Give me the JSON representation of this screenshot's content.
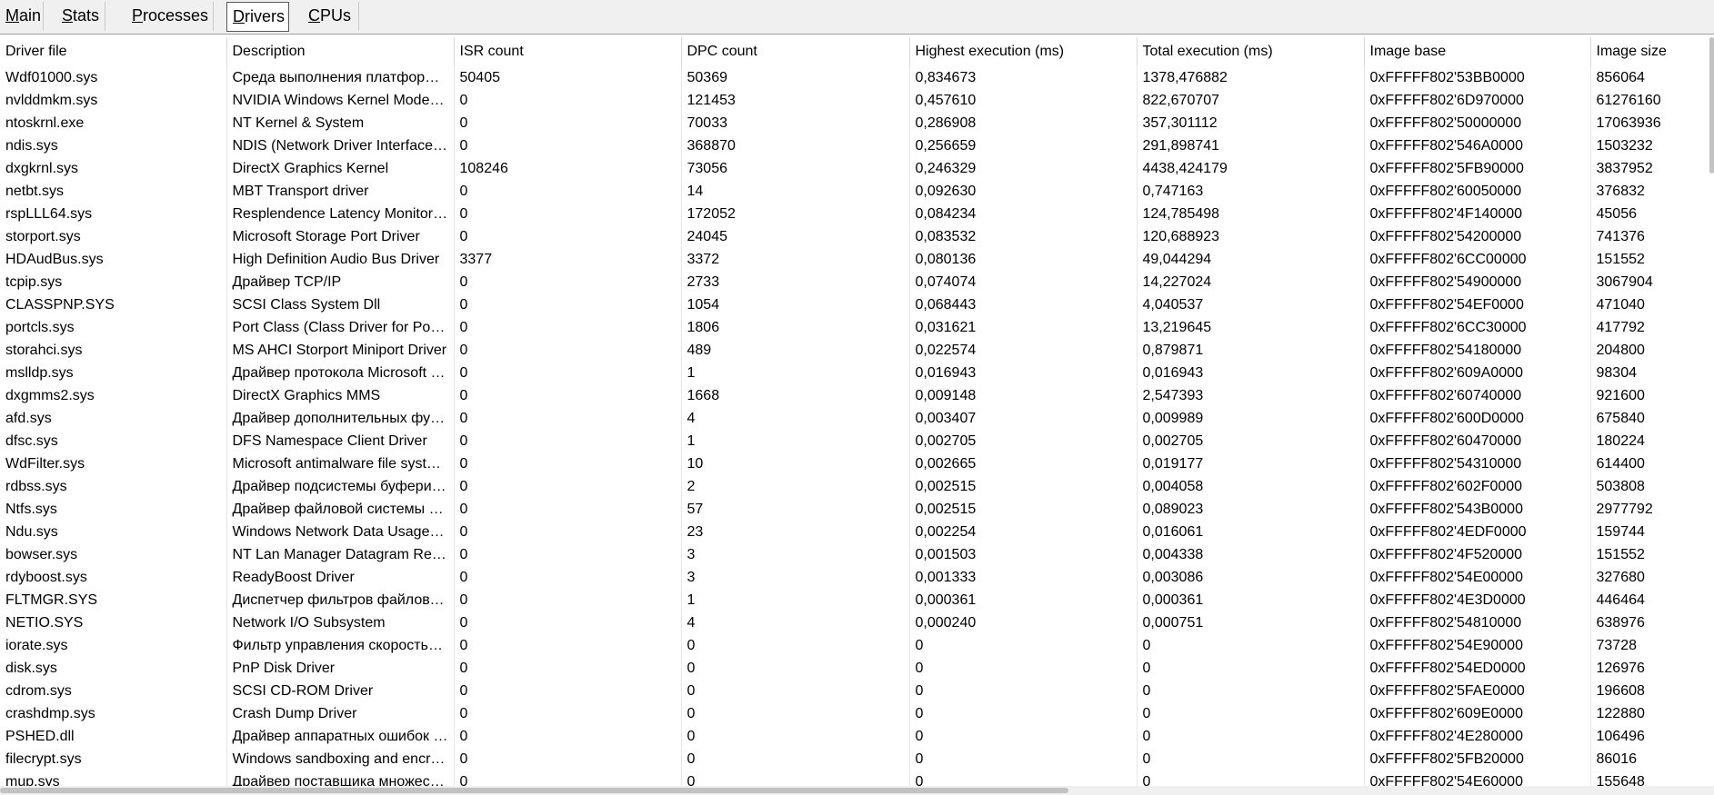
{
  "tabs": [
    {
      "key": "M",
      "rest": "ain",
      "active": false
    },
    {
      "key": "S",
      "rest": "tats",
      "active": false
    },
    {
      "key": "P",
      "rest": "rocesses",
      "active": false
    },
    {
      "key": "D",
      "rest": "rivers",
      "active": true
    },
    {
      "key": "C",
      "rest": "PUs",
      "active": false
    }
  ],
  "columns": [
    "Driver file",
    "Description",
    "ISR count",
    "DPC count",
    "Highest execution (ms)",
    "Total execution (ms)",
    "Image base",
    "Image size"
  ],
  "rows": [
    [
      "Wdf01000.sys",
      "Среда выполнения платформы драйверов ядра",
      "50405",
      "50369",
      "0,834673",
      "1378,476882",
      "0xFFFFF802'53BB0000",
      "856064"
    ],
    [
      "nvlddmkm.sys",
      "NVIDIA Windows Kernel Mode Driver",
      "0",
      "121453",
      "0,457610",
      "822,670707",
      "0xFFFFF802'6D970000",
      "61276160"
    ],
    [
      "ntoskrnl.exe",
      "NT Kernel & System",
      "0",
      "70033",
      "0,286908",
      "357,301112",
      "0xFFFFF802'50000000",
      "17063936"
    ],
    [
      "ndis.sys",
      "NDIS (Network Driver Interface Specification)",
      "0",
      "368870",
      "0,256659",
      "291,898741",
      "0xFFFFF802'546A0000",
      "1503232"
    ],
    [
      "dxgkrnl.sys",
      "DirectX Graphics Kernel",
      "108246",
      "73056",
      "0,246329",
      "4438,424179",
      "0xFFFFF802'5FB90000",
      "3837952"
    ],
    [
      "netbt.sys",
      "MBT Transport driver",
      "0",
      "14",
      "0,092630",
      "0,747163",
      "0xFFFFF802'60050000",
      "376832"
    ],
    [
      "rspLLL64.sys",
      "Resplendence Latency Monitoring Driver",
      "0",
      "172052",
      "0,084234",
      "124,785498",
      "0xFFFFF802'4F140000",
      "45056"
    ],
    [
      "storport.sys",
      "Microsoft Storage Port Driver",
      "0",
      "24045",
      "0,083532",
      "120,688923",
      "0xFFFFF802'54200000",
      "741376"
    ],
    [
      "HDAudBus.sys",
      "High Definition Audio Bus Driver",
      "3377",
      "3372",
      "0,080136",
      "49,044294",
      "0xFFFFF802'6CC00000",
      "151552"
    ],
    [
      "tcpip.sys",
      "Драйвер TCP/IP",
      "0",
      "2733",
      "0,074074",
      "14,227024",
      "0xFFFFF802'54900000",
      "3067904"
    ],
    [
      "CLASSPNP.SYS",
      "SCSI Class System Dll",
      "0",
      "1054",
      "0,068443",
      "4,040537",
      "0xFFFFF802'54EF0000",
      "471040"
    ],
    [
      "portcls.sys",
      "Port Class (Class Driver for Port/Miniport Devices)",
      "0",
      "1806",
      "0,031621",
      "13,219645",
      "0xFFFFF802'6CC30000",
      "417792"
    ],
    [
      "storahci.sys",
      "MS AHCI Storport Miniport Driver",
      "0",
      "489",
      "0,022574",
      "0,879871",
      "0xFFFFF802'54180000",
      "204800"
    ],
    [
      "mslldp.sys",
      "Драйвер протокола Microsoft LLDP",
      "0",
      "1",
      "0,016943",
      "0,016943",
      "0xFFFFF802'609A0000",
      "98304"
    ],
    [
      "dxgmms2.sys",
      "DirectX Graphics MMS",
      "0",
      "1668",
      "0,009148",
      "2,547393",
      "0xFFFFF802'60740000",
      "921600"
    ],
    [
      "afd.sys",
      "Драйвер дополнительных функций",
      "0",
      "4",
      "0,003407",
      "0,009989",
      "0xFFFFF802'600D0000",
      "675840"
    ],
    [
      "dfsc.sys",
      "DFS Namespace Client Driver",
      "0",
      "1",
      "0,002705",
      "0,002705",
      "0xFFFFF802'60470000",
      "180224"
    ],
    [
      "WdFilter.sys",
      "Microsoft antimalware file system filter",
      "0",
      "10",
      "0,002665",
      "0,019177",
      "0xFFFFF802'54310000",
      "614400"
    ],
    [
      "rdbss.sys",
      "Драйвер подсистемы буферизации",
      "0",
      "2",
      "0,002515",
      "0,004058",
      "0xFFFFF802'602F0000",
      "503808"
    ],
    [
      "Ntfs.sys",
      "Драйвер файловой системы NT",
      "0",
      "57",
      "0,002515",
      "0,089023",
      "0xFFFFF802'543B0000",
      "2977792"
    ],
    [
      "Ndu.sys",
      "Windows Network Data Usage Monitoring Driver",
      "0",
      "23",
      "0,002254",
      "0,016061",
      "0xFFFFF802'4EDF0000",
      "159744"
    ],
    [
      "bowser.sys",
      "NT Lan Manager Datagram Receiver Driver",
      "0",
      "3",
      "0,001503",
      "0,004338",
      "0xFFFFF802'4F520000",
      "151552"
    ],
    [
      "rdyboost.sys",
      "ReadyBoost Driver",
      "0",
      "3",
      "0,001333",
      "0,003086",
      "0xFFFFF802'54E00000",
      "327680"
    ],
    [
      "FLTMGR.SYS",
      "Диспетчер фильтров файловой системы",
      "0",
      "1",
      "0,000361",
      "0,000361",
      "0xFFFFF802'4E3D0000",
      "446464"
    ],
    [
      "NETIO.SYS",
      "Network I/O Subsystem",
      "0",
      "4",
      "0,000240",
      "0,000751",
      "0xFFFFF802'54810000",
      "638976"
    ],
    [
      "iorate.sys",
      "Фильтр управления скоростью ввода-вывода",
      "0",
      "0",
      "0",
      "0",
      "0xFFFFF802'54E90000",
      "73728"
    ],
    [
      "disk.sys",
      "PnP Disk Driver",
      "0",
      "0",
      "0",
      "0",
      "0xFFFFF802'54ED0000",
      "126976"
    ],
    [
      "cdrom.sys",
      "SCSI CD-ROM Driver",
      "0",
      "0",
      "0",
      "0",
      "0xFFFFF802'5FAE0000",
      "196608"
    ],
    [
      "crashdmp.sys",
      "Crash Dump Driver",
      "0",
      "0",
      "0",
      "0",
      "0xFFFFF802'609E0000",
      "122880"
    ],
    [
      "PSHED.dll",
      "Драйвер аппаратных ошибок платформы",
      "0",
      "0",
      "0",
      "0",
      "0xFFFFF802'4E280000",
      "106496"
    ],
    [
      "filecrypt.sys",
      "Windows sandboxing and encryption filter",
      "0",
      "0",
      "0",
      "0",
      "0xFFFFF802'5FB20000",
      "86016"
    ],
    [
      "mup.sys",
      "Драйвер поставщика множественных UNC",
      "0",
      "0",
      "0",
      "0",
      "0xFFFFF802'54E60000",
      "155648"
    ]
  ]
}
